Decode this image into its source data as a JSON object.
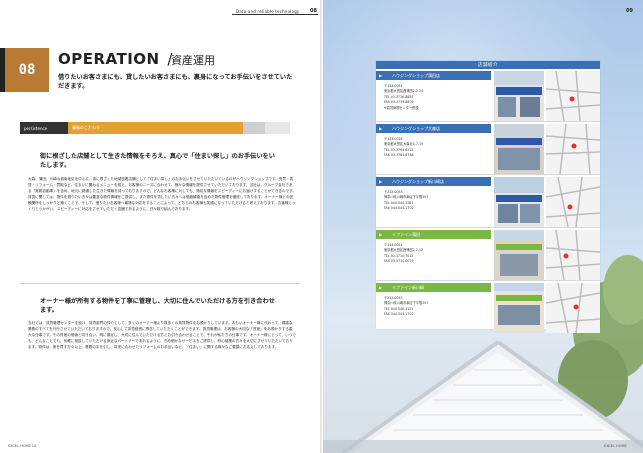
{
  "header": {
    "running_title": "Data and reliable technology",
    "page_number_left": "08",
    "page_number_right": "09"
  },
  "section": {
    "number": "08",
    "title_en": "OPERATION",
    "title_slash": "/",
    "title_ja": "資産運用",
    "lead": "借りたいお客さまにも、貸したいお客さまにも、裏身になってお手伝いをさせていただきます。"
  },
  "tagbar": {
    "label_en": "persistence",
    "label_ja": "業務のこだわり"
  },
  "block1": {
    "heading": "街に根ざした店舗として生きた情報をそろえ、真心で「住まい探し」のお手伝いをいたします。",
    "body": "大森、蒲田、川崎の城南地区を中心に、街に根ざした地域密着店舗として「住まい探し」のお手伝いをさせていただいているのがハウジングショップです。売買・賃貸・リフォーム・買取など、住まいに関わるメニューを揃え、お客様のニーズに合わせて、様々な情報を提供させていただいております。当社は、グループ会社である「実務自動車」を含め、地元に精通した生きた情報を持っておりますので、どんなお客様に対しても、適切な情報をスピーディーにお届けすることができるのです。賃貸に関しては、物件を借りたい方々は豊富な物件情報をご提供し、また物件を貸したい方々へは価値観査を含めた物件管理を徹底しております。オーナー様との信頼関係をしっかりと築くことで、そして、借りたいお客様へ最適な対応をすることによって、どちらのお客様も笑顔になっていただけると考えております。お客様じっくりとうかがい、スピーディーに対応をさせていただく店舗であるように、日々取り組んでおります。"
  },
  "block2": {
    "heading": "オーナー様が所有する物件を丁寧に管理し、大切に住んでいただける方を引き合わせます。",
    "body": "当社では、賃貸管理センターを設け、賃貸部門の仲介として、多くのオーナー様より数多くの賃貸物件をお預かりしています。おもいオーナー様に代わって、煩雑な業務のすべてを代行させていただいておりますので、安心して賃貸経営に専念していただくことができます。賃貸管理は、お客様の大切な「資産」をお預かりする重大な仕事です。その資産の価値と向き合い、明に満足し、大切に住んでいただける方とお引き合わせることで、それが私たちの仕事です。オーナー様にとって、いつでも、どんなことでも、気軽に相談していただける身近なパートナーであれるように、きめ細かなサービスをご提供し、絆心継業の方々を大切にさせていただいております。物件は、家を買す方々以上、業務の手を引し、将来に合わせたリフォームのお手伝いなど、「住まい」に関する様々なご要望にお応えしております。"
  },
  "footer": {
    "left": "EXCEL HOME 10",
    "right": "EXCEL HOME"
  },
  "store_panel": {
    "title": "店舗紹介",
    "stores": [
      {
        "name": "ハウジングショップ蒲田店",
        "info": "〒144-0051\n東京都大田区西蒲田2-2-10\nTEL 03-3736-8855\nFAX 03-3739-8809\n※賃貸管理センター併設",
        "color": "#3b6fb3"
      },
      {
        "name": "ハウジングショップ大森店",
        "info": "〒143-0016\n東京都大田区大森北4-7-15\nTEL 03-3764-6212\nFAX 03-3764-6788",
        "color": "#3b6fb3"
      },
      {
        "name": "ハウジングショップ新川崎店",
        "info": "〒212-0053\n神奈川県川崎市幸区下平間207\nTEL 044-544-1281\nFAX 044-544-1702",
        "color": "#3b6fb3"
      },
      {
        "name": "リファイン蒲田",
        "info": "〒144-0051\n東京都大田区西蒲田2-2-12\nTEL 03-5710-7012\nFAX 03-5710-0079",
        "color": "#79b843"
      },
      {
        "name": "リファイン新川崎",
        "info": "〒212-0053\n神奈川県川崎市幸区下平間207\nTEL 044-540-3121\nFAX 044-544-1702",
        "color": "#79b843"
      }
    ]
  },
  "colors": {
    "accent_orange": "#e5a033",
    "number_box": "#b97a33",
    "store_blue": "#3b6fb3",
    "store_green": "#79b843"
  }
}
